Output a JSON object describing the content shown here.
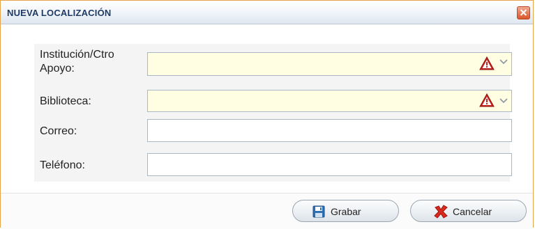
{
  "dialog": {
    "title": "NUEVA LOCALIZACIÓN"
  },
  "form": {
    "institucion_label": "Institución/Ctro Apoyo:",
    "biblioteca_label": "Biblioteca:",
    "correo_label": "Correo:",
    "telefono_label": "Teléfono:",
    "institucion_value": "",
    "biblioteca_value": "",
    "correo_value": "",
    "telefono_value": ""
  },
  "buttons": {
    "grabar_label": "Grabar",
    "cancelar_label": "Cancelar"
  },
  "icons": {
    "close": "close-icon",
    "warning": "warning-icon",
    "chevron": "chevron-down-icon",
    "save": "floppy-disk-icon",
    "cancel": "red-x-icon"
  },
  "colors": {
    "title_text": "#1d3b66",
    "dialog_border": "#e8a24a",
    "required_field_bg": "#fffde2",
    "warning_red": "#c8231e"
  }
}
